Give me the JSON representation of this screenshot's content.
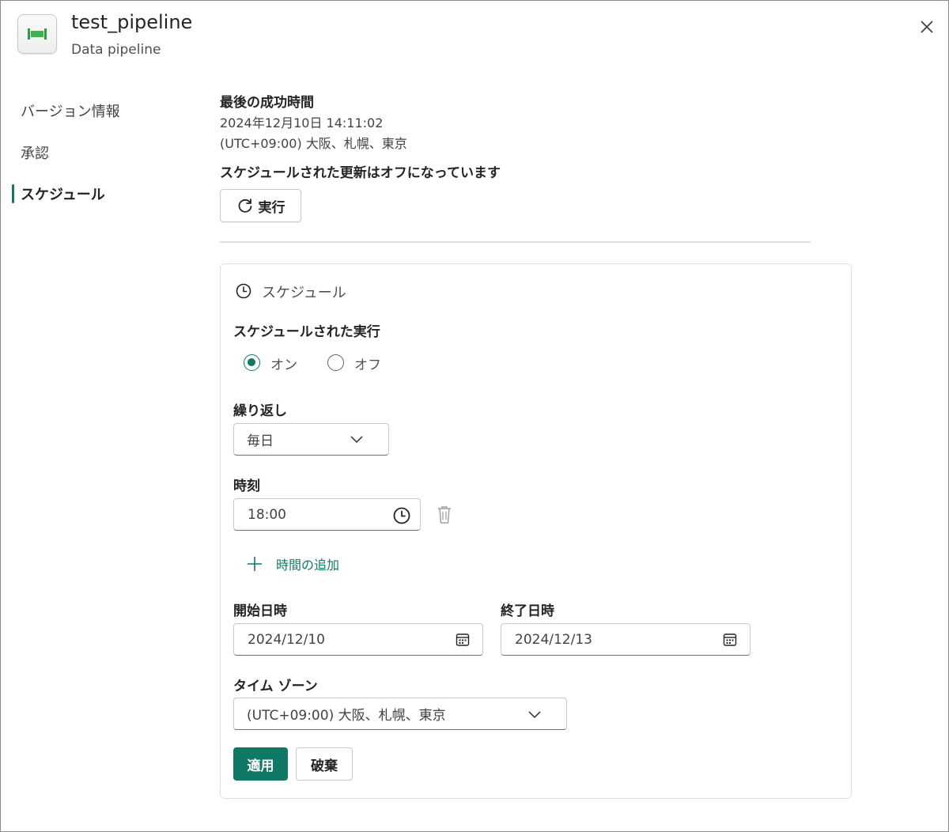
{
  "header": {
    "title": "test_pipeline",
    "subtitle": "Data pipeline",
    "icon": "pipeline-icon",
    "accent": "#2e9d3c"
  },
  "nav": {
    "items": [
      {
        "label": "バージョン情報",
        "active": false
      },
      {
        "label": "承認",
        "active": false
      },
      {
        "label": "スケジュール",
        "active": true
      }
    ]
  },
  "summary": {
    "last_success_label": "最後の成功時間",
    "last_success_datetime": "2024年12月10日 14:11:02",
    "last_success_timezone": "(UTC+09:00) 大阪、札幌、東京",
    "status_text": "スケジュールされた更新はオフになっています",
    "run_button_label": "実行"
  },
  "schedule": {
    "section_title": "スケジュール",
    "scheduled_run_label": "スケジュールされた実行",
    "on_label": "オン",
    "off_label": "オフ",
    "selected": "on",
    "repeat_label": "繰り返し",
    "repeat_value": "毎日",
    "time_label": "時刻",
    "time_value": "18:00",
    "add_time_label": "時間の追加",
    "start_label": "開始日時",
    "start_value": "2024/12/10",
    "end_label": "終了日時",
    "end_value": "2024/12/13",
    "timezone_label": "タイム ゾーン",
    "timezone_value": "(UTC+09:00) 大阪、札幌、東京",
    "apply_label": "適用",
    "discard_label": "破棄"
  },
  "colors": {
    "brand": "#117865",
    "border": "#c8c8c8",
    "text": "#242424"
  }
}
